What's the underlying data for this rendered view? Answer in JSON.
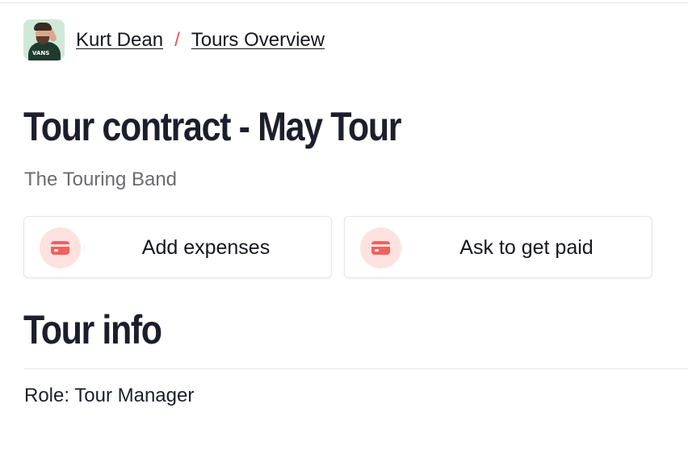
{
  "breadcrumb": {
    "user_name": "Kurt Dean",
    "separator": "/",
    "page": "Tours Overview"
  },
  "header": {
    "title": "Tour contract - May Tour",
    "subtitle": "The Touring Band"
  },
  "actions": [
    {
      "label": "Add expenses",
      "icon": "credit-card-icon"
    },
    {
      "label": "Ask to get paid",
      "icon": "credit-card-icon"
    }
  ],
  "tour_info": {
    "heading": "Tour info",
    "role_line": "Role: Tour Manager"
  },
  "avatar": {
    "shirt_text": "VANS"
  },
  "colors": {
    "accent": "#f2615e",
    "accent_soft": "#fde2e0",
    "text": "#1c1f2b",
    "muted": "#6b6b70",
    "border": "#e6e6ea"
  }
}
